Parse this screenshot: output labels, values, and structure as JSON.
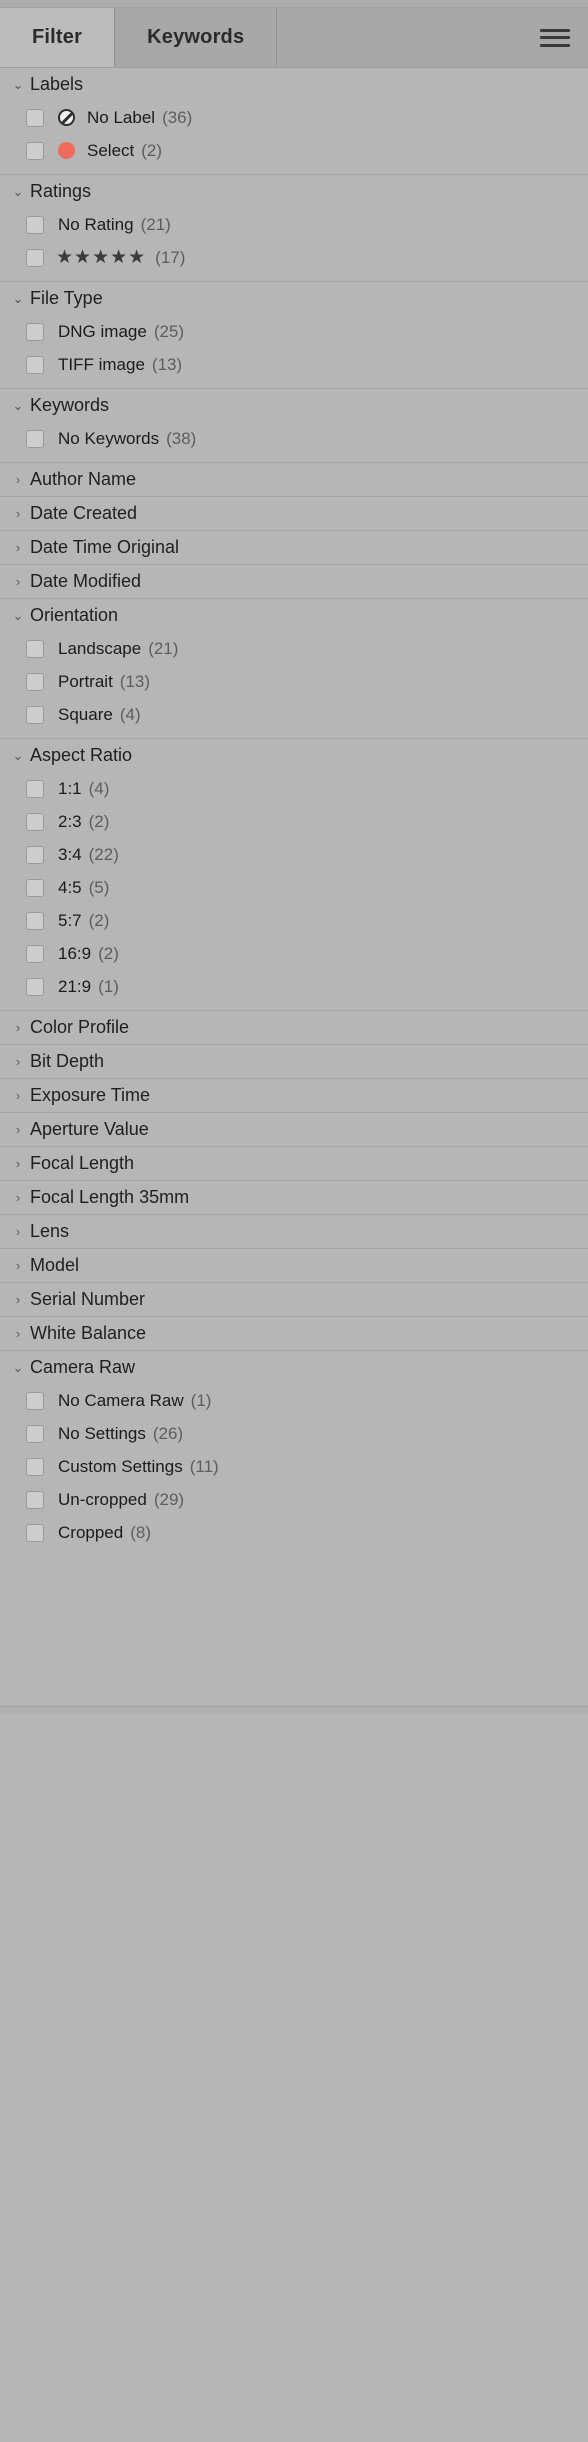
{
  "header": {
    "tabs": [
      {
        "label": "Filter",
        "active": true
      },
      {
        "label": "Keywords",
        "active": false
      }
    ],
    "menu_icon": "hamburger-icon"
  },
  "colors": {
    "panel_bg": "#b6b6b6",
    "tab_active_bg": "#bcbcbc",
    "tab_inactive_bg": "#a8a8a8",
    "divider": "#a5a5a5",
    "label_select_red": "#ef6a5a",
    "checkbox_bg": "#cdcdcd"
  },
  "sections": [
    {
      "title": "Labels",
      "expanded": true,
      "items": [
        {
          "label": "No Label",
          "count": "(36)",
          "swatch": "no-label-icon"
        },
        {
          "label": "Select",
          "count": "(2)",
          "swatch": "red-label-icon"
        }
      ]
    },
    {
      "title": "Ratings",
      "expanded": true,
      "items": [
        {
          "label": "No Rating",
          "count": "(21)"
        },
        {
          "label": "★★★★★",
          "count": "(17)",
          "stars": 5
        }
      ]
    },
    {
      "title": "File Type",
      "expanded": true,
      "items": [
        {
          "label": "DNG image",
          "count": "(25)"
        },
        {
          "label": "TIFF image",
          "count": "(13)"
        }
      ]
    },
    {
      "title": "Keywords",
      "expanded": true,
      "items": [
        {
          "label": "No Keywords",
          "count": "(38)"
        }
      ]
    },
    {
      "title": "Author Name",
      "expanded": false,
      "items": []
    },
    {
      "title": "Date Created",
      "expanded": false,
      "items": []
    },
    {
      "title": "Date Time Original",
      "expanded": false,
      "items": []
    },
    {
      "title": "Date Modified",
      "expanded": false,
      "items": []
    },
    {
      "title": "Orientation",
      "expanded": true,
      "items": [
        {
          "label": "Landscape",
          "count": "(21)"
        },
        {
          "label": "Portrait",
          "count": "(13)"
        },
        {
          "label": "Square",
          "count": "(4)"
        }
      ]
    },
    {
      "title": "Aspect Ratio",
      "expanded": true,
      "items": [
        {
          "label": "1:1",
          "count": "(4)"
        },
        {
          "label": "2:3",
          "count": "(2)"
        },
        {
          "label": "3:4",
          "count": "(22)"
        },
        {
          "label": "4:5",
          "count": "(5)"
        },
        {
          "label": "5:7",
          "count": "(2)"
        },
        {
          "label": "16:9",
          "count": "(2)"
        },
        {
          "label": "21:9",
          "count": "(1)"
        }
      ]
    },
    {
      "title": "Color Profile",
      "expanded": false,
      "items": []
    },
    {
      "title": "Bit Depth",
      "expanded": false,
      "items": []
    },
    {
      "title": "Exposure Time",
      "expanded": false,
      "items": []
    },
    {
      "title": "Aperture Value",
      "expanded": false,
      "items": []
    },
    {
      "title": "Focal Length",
      "expanded": false,
      "items": []
    },
    {
      "title": "Focal Length 35mm",
      "expanded": false,
      "items": []
    },
    {
      "title": "Lens",
      "expanded": false,
      "items": []
    },
    {
      "title": "Model",
      "expanded": false,
      "items": []
    },
    {
      "title": "Serial Number",
      "expanded": false,
      "items": []
    },
    {
      "title": "White Balance",
      "expanded": false,
      "items": []
    },
    {
      "title": "Camera Raw",
      "expanded": true,
      "items": [
        {
          "label": "No Camera Raw",
          "count": "(1)"
        },
        {
          "label": "No Settings",
          "count": "(26)"
        },
        {
          "label": "Custom Settings",
          "count": "(11)"
        },
        {
          "label": "Un-cropped",
          "count": "(29)"
        },
        {
          "label": "Cropped",
          "count": "(8)"
        }
      ]
    }
  ],
  "icons": {
    "caret_expanded": "⌄",
    "caret_collapsed": "›"
  }
}
